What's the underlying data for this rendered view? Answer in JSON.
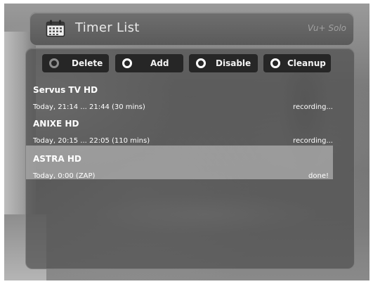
{
  "window": {
    "title": "Timer List",
    "watermark": "Vu+ Solo"
  },
  "toolbar": {
    "buttons": [
      {
        "label": "Delete",
        "indicator": "dim"
      },
      {
        "label": "Add",
        "indicator": "white"
      },
      {
        "label": "Disable",
        "indicator": "white"
      },
      {
        "label": "Cleanup",
        "indicator": "white"
      }
    ]
  },
  "timers": [
    {
      "channel": "Servus TV HD",
      "time": "Today, 21:14 ... 21:44 (30 mins)",
      "status": "recording..."
    },
    {
      "channel": "ANIXE HD",
      "time": "Today, 20:15 ... 22:05 (110 mins)",
      "status": "recording..."
    },
    {
      "channel": "ASTRA HD",
      "time": "Today, 0:00 (ZAP)",
      "status": "done!",
      "selected": true
    }
  ],
  "colors": {
    "button_bg": "#262626",
    "selected_row": "#cdcdcd",
    "text": "#ffffff"
  }
}
